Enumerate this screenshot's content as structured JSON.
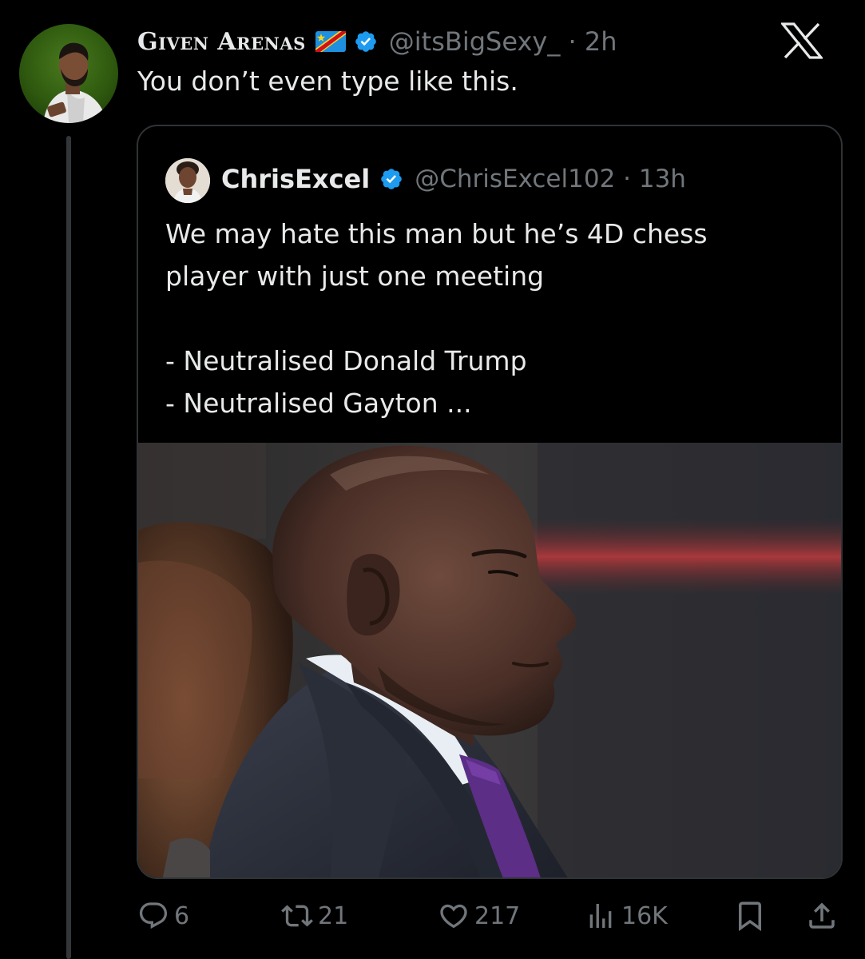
{
  "tweet": {
    "display_name": "Given Arenas",
    "handle_time": "@itsBigSexy_ · 2h",
    "text": "You don’t even type like this."
  },
  "quote": {
    "display_name": "ChrisExcel",
    "handle_time": "@ChrisExcel102 · 13h",
    "lines": [
      "We may hate this man but he’s 4D chess",
      "player with just one meeting",
      "",
      "- Neutralised Donald Trump",
      "- Neutralised Gayton ..."
    ]
  },
  "actions": {
    "replies": "6",
    "reposts": "21",
    "likes": "217",
    "views": "16K"
  },
  "icons": {
    "app_logo": "x-logo-icon",
    "verified": "verified-badge-icon",
    "flag": "dr-congo-flag-icon",
    "reply": "reply-icon",
    "repost": "repost-icon",
    "like": "like-icon",
    "views": "views-icon",
    "bookmark": "bookmark-icon",
    "share": "share-icon"
  },
  "colors": {
    "background": "#000000",
    "text_primary": "#e7e9ea",
    "text_secondary": "#71767b",
    "verified_blue": "#1d9bf0",
    "border": "#2f3336"
  }
}
